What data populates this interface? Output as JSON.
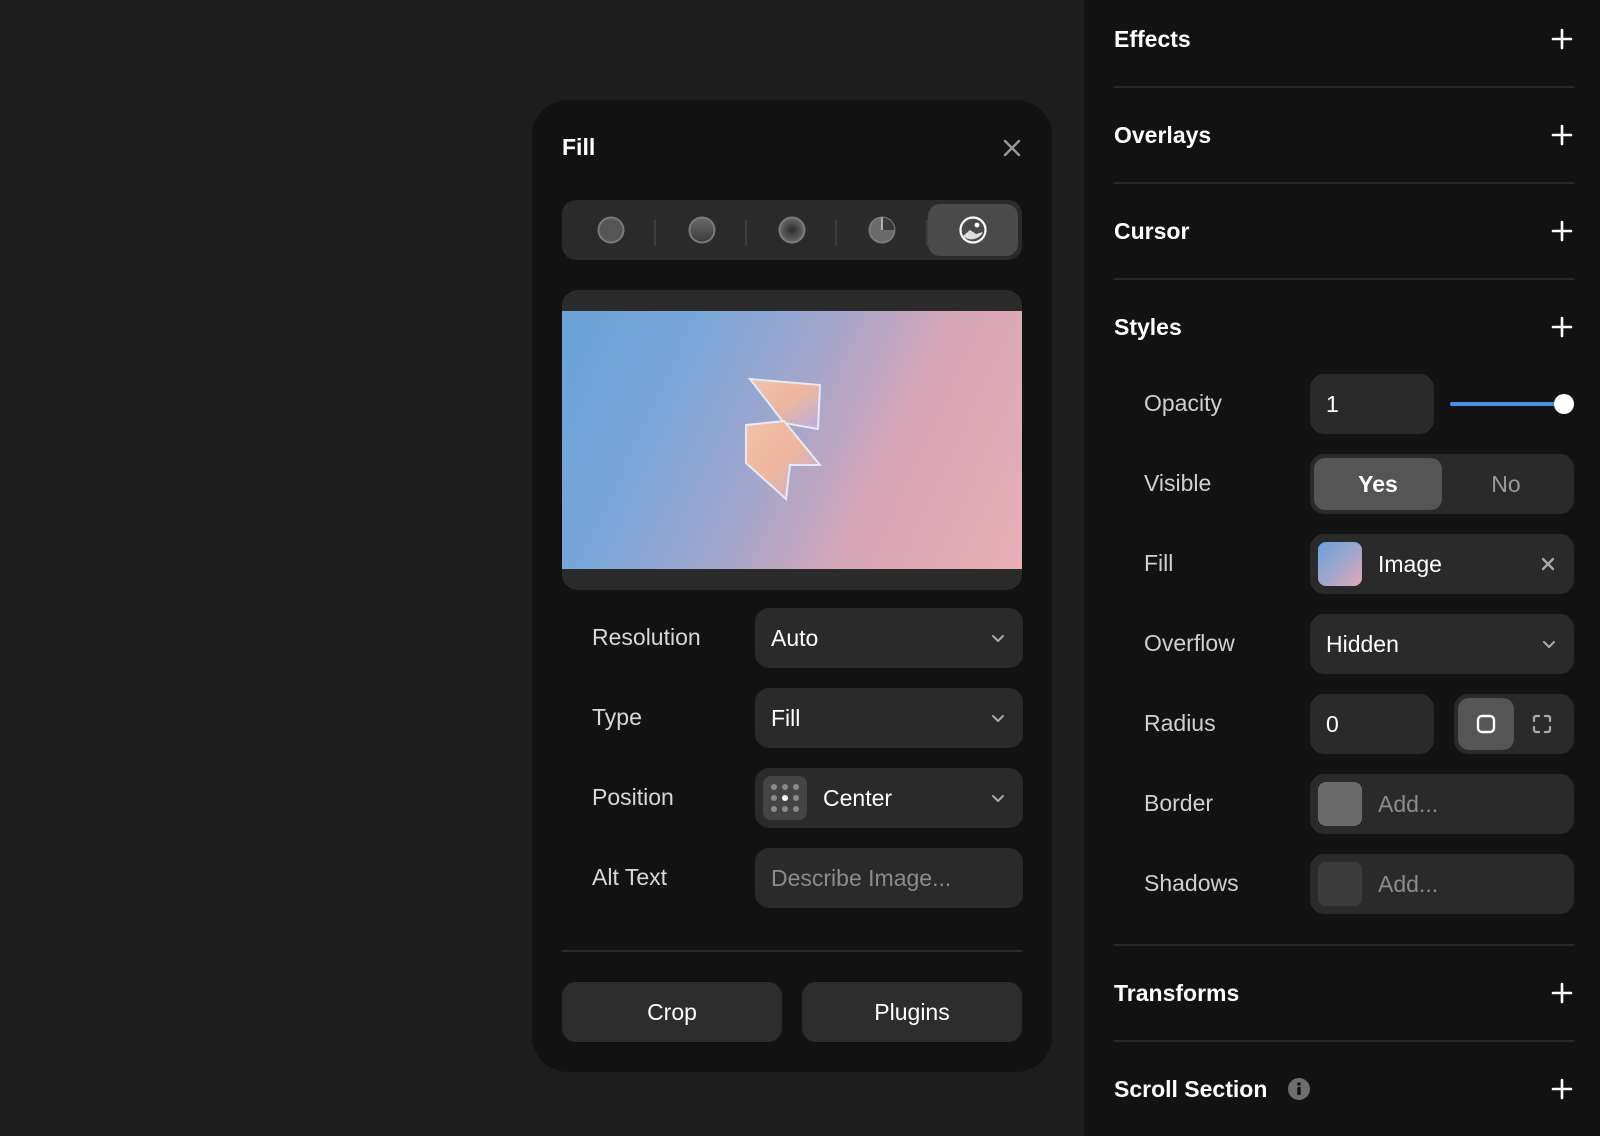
{
  "fill_popover": {
    "title": "Fill",
    "fill_types": [
      {
        "name": "solid-color",
        "active": false
      },
      {
        "name": "linear-gradient",
        "active": false
      },
      {
        "name": "radial-gradient",
        "active": false
      },
      {
        "name": "conic-gradient",
        "active": false
      },
      {
        "name": "image",
        "active": true
      }
    ],
    "fields": {
      "resolution": {
        "label": "Resolution",
        "value": "Auto"
      },
      "type": {
        "label": "Type",
        "value": "Fill"
      },
      "position": {
        "label": "Position",
        "value": "Center"
      },
      "alt_text": {
        "label": "Alt Text",
        "value": "",
        "placeholder": "Describe Image..."
      }
    },
    "buttons": {
      "crop": "Crop",
      "plugins": "Plugins"
    }
  },
  "panel": {
    "sections": {
      "effects": "Effects",
      "overlays": "Overlays",
      "cursor": "Cursor",
      "styles": "Styles",
      "transforms": "Transforms",
      "scroll_section": "Scroll Section"
    },
    "styles": {
      "opacity": {
        "label": "Opacity",
        "value": "1",
        "slider_fraction": 1.0
      },
      "visible": {
        "label": "Visible",
        "options": [
          "Yes",
          "No"
        ],
        "selected": "Yes"
      },
      "fill": {
        "label": "Fill",
        "value": "Image"
      },
      "overflow": {
        "label": "Overflow",
        "value": "Hidden"
      },
      "radius": {
        "label": "Radius",
        "value": "0",
        "mode": "uniform"
      },
      "border": {
        "label": "Border",
        "placeholder": "Add..."
      },
      "shadows": {
        "label": "Shadows",
        "placeholder": "Add..."
      }
    },
    "colors": {
      "accent": "#4b8fe8",
      "panel_bg": "#121212",
      "control_bg": "#2a2a2a"
    }
  }
}
